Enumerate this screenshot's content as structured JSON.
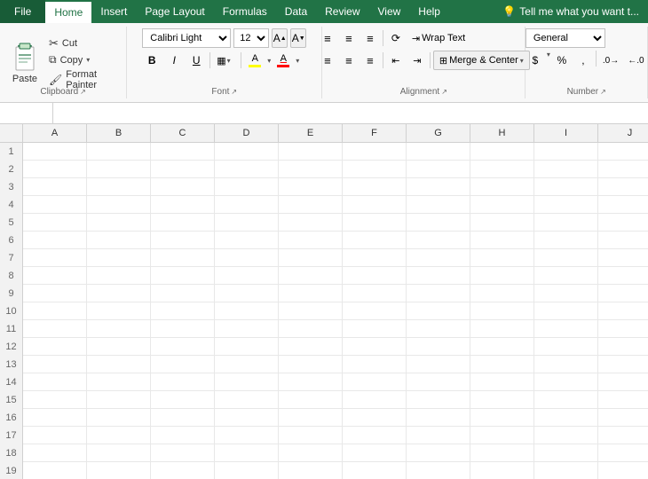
{
  "menubar": {
    "file": "File",
    "home": "Home",
    "insert": "Insert",
    "page_layout": "Page Layout",
    "formulas": "Formulas",
    "data": "Data",
    "review": "Review",
    "view": "View",
    "help": "Help",
    "tell_me": "Tell me what you want t..."
  },
  "ribbon": {
    "clipboard": {
      "label": "Clipboard",
      "paste": "Paste",
      "cut": "Cut",
      "copy": "Copy",
      "format_painter": "Format Painter"
    },
    "font": {
      "label": "Font",
      "font_name": "Calibri Light",
      "font_size": "12",
      "bold": "B",
      "italic": "I",
      "underline": "U",
      "borders": "▦",
      "fill_color": "A",
      "font_color": "A"
    },
    "alignment": {
      "label": "Alignment",
      "wrap_text": "Wrap Text",
      "merge_center": "Merge & Center"
    },
    "number": {
      "label": "Number",
      "format": "General"
    }
  },
  "spreadsheet": {
    "columns": [
      "A",
      "B",
      "C",
      "D",
      "E",
      "F",
      "G",
      "H",
      "I",
      "J"
    ],
    "rows": [
      1,
      2,
      3,
      4,
      5,
      6,
      7,
      8,
      9,
      10,
      11,
      12,
      13,
      14,
      15,
      16,
      17,
      18,
      19
    ]
  }
}
